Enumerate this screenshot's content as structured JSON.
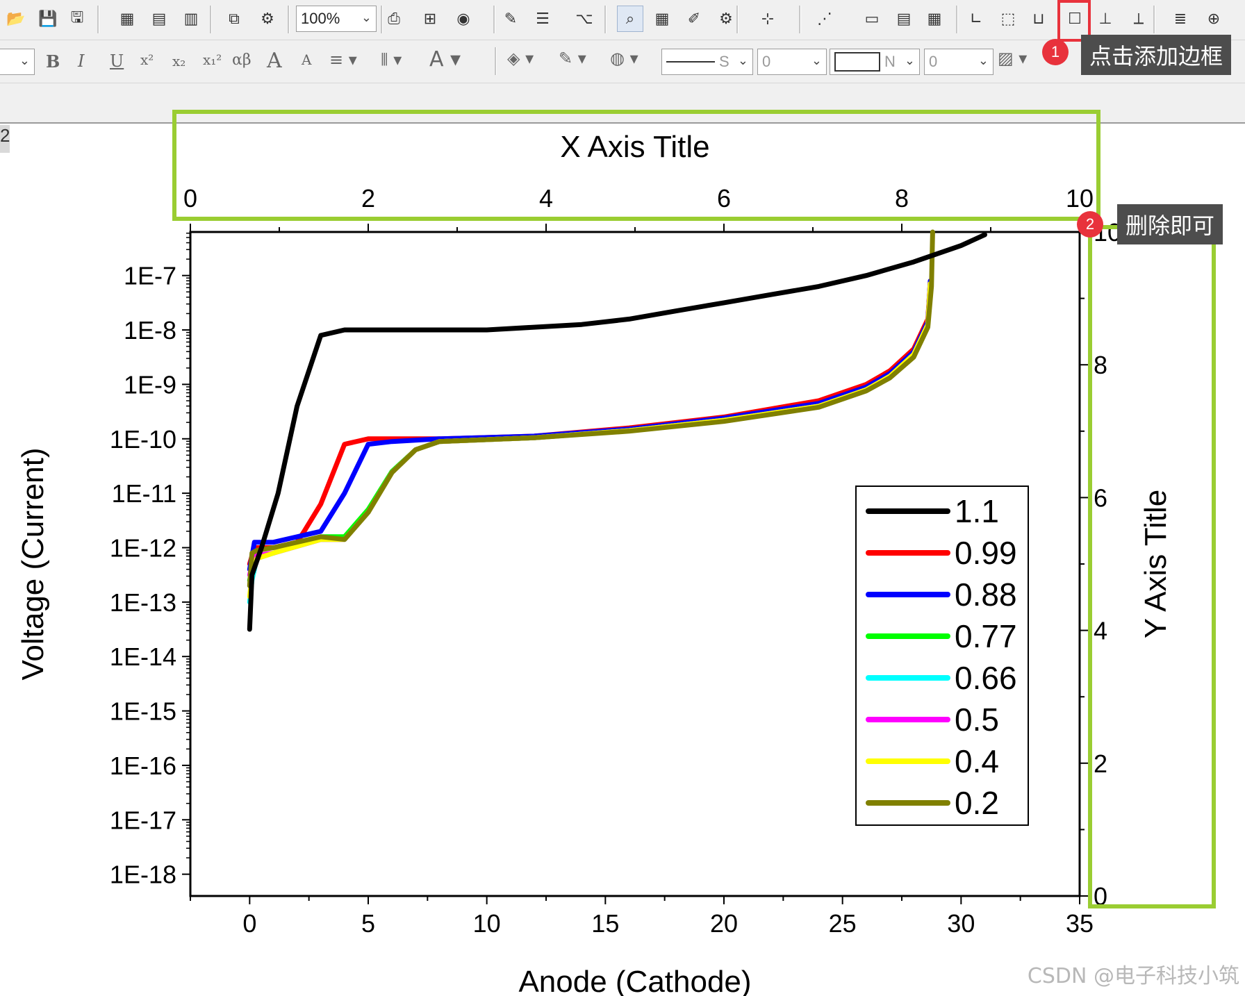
{
  "toolbar1": {
    "zoom_value": "100%",
    "icons": [
      "open-icon",
      "save-icon",
      "save-template-icon",
      "import-icon",
      "import-multi-icon",
      "import-wizard-icon",
      "duplicate-icon",
      "run-icon",
      "print-icon",
      "export-icon",
      "copy-page-icon",
      "code-builder-icon",
      "layer-icon",
      "tree-icon",
      "zoom-icon",
      "worksheet-icon",
      "notes-icon",
      "gear-icon",
      "add-axis-icon",
      "data-selector-icon",
      "layer-1-icon",
      "layer-2-icon",
      "layer-4-icon",
      "axis-l-icon",
      "axis-box-icon",
      "axis-right-icon",
      "border-icon",
      "axis-yy-icon",
      "axis-xy-icon",
      "list-icon",
      "plus-icon"
    ]
  },
  "toolbar2": {
    "font_combo": "",
    "bold": "B",
    "italic": "I",
    "underline": "U",
    "superscript": "x²",
    "subscript": "x₂",
    "supersub": "x₁²",
    "greek": "αβ",
    "font_up": "A",
    "font_down": "A",
    "line_style_combo": "S",
    "line_width_combo": "0",
    "fill_combo": "N",
    "fill_width_combo": "0"
  },
  "annotations": {
    "badge1": "1",
    "tip1": "点击添加边框",
    "badge2": "2",
    "tip2": "删除即可",
    "tab_fragment": "2",
    "watermark": "CSDN @电子科技小筑"
  },
  "colors": {
    "highlight_red": "#e8323c",
    "highlight_green": "#9acd32",
    "tooltip_bg": "#4d4d4d"
  },
  "chart_data": {
    "type": "line",
    "xlabel": "Anode (Cathode)",
    "ylabel": "Voltage (Current)",
    "xlim": [
      -2.5,
      35
    ],
    "x_ticks": [
      0,
      5,
      10,
      15,
      20,
      25,
      30,
      35
    ],
    "y_scale": "log",
    "ylim_exponent": [
      -18.4,
      -6.2
    ],
    "y_tick_labels": [
      "1E-7",
      "1E-8",
      "1E-9",
      "1E-10",
      "1E-11",
      "1E-12",
      "1E-13",
      "1E-14",
      "1E-15",
      "1E-16",
      "1E-17",
      "1E-18"
    ],
    "top_axis": {
      "title": "X Axis Title",
      "ticks": [
        "0",
        "2",
        "4",
        "6",
        "8",
        "10"
      ],
      "range": [
        0,
        10
      ]
    },
    "right_axis": {
      "title": "Y Axis Title",
      "ticks": [
        "0",
        "2",
        "4",
        "6",
        "8",
        "10"
      ],
      "range": [
        0,
        10
      ]
    },
    "legend_position": "right",
    "series": [
      {
        "name": "1.1",
        "color": "#000000",
        "x": [
          0,
          0.1,
          0.5,
          1.2,
          2,
          3,
          4,
          6,
          8,
          10,
          12,
          14,
          16,
          18,
          20,
          22,
          24,
          26,
          28,
          30,
          31
        ],
        "log10y": [
          -13.5,
          -12.5,
          -12.0,
          -11.0,
          -9.4,
          -8.1,
          -8.0,
          -8.0,
          -8.0,
          -8.0,
          -7.95,
          -7.9,
          -7.8,
          -7.65,
          -7.5,
          -7.35,
          -7.2,
          -7.0,
          -6.75,
          -6.45,
          -6.25
        ]
      },
      {
        "name": "0.99",
        "color": "#ff0000",
        "x": [
          0,
          0.2,
          1,
          2,
          2.3,
          3,
          4,
          5,
          8,
          12,
          16,
          20,
          24,
          26,
          27,
          28,
          28.6,
          28.7
        ],
        "log10y": [
          -12.3,
          -12.0,
          -12.0,
          -11.9,
          -11.7,
          -11.2,
          -10.1,
          -10.0,
          -10.0,
          -9.95,
          -9.8,
          -9.6,
          -9.3,
          -9.0,
          -8.75,
          -8.35,
          -7.8,
          -7.1
        ]
      },
      {
        "name": "0.88",
        "color": "#0000ff",
        "x": [
          0,
          0.2,
          1,
          3,
          4,
          5,
          6,
          8,
          12,
          16,
          20,
          24,
          26,
          27,
          28,
          28.6,
          28.7
        ],
        "log10y": [
          -12.4,
          -11.9,
          -11.9,
          -11.7,
          -11.0,
          -10.1,
          -10.05,
          -10.0,
          -9.95,
          -9.82,
          -9.62,
          -9.35,
          -9.05,
          -8.8,
          -8.4,
          -7.85,
          -7.1
        ]
      },
      {
        "name": "0.77",
        "color": "#00ff00",
        "x": [
          0,
          0.2,
          1,
          3,
          4,
          5,
          6,
          7,
          8,
          12,
          16,
          20,
          24,
          26,
          27,
          28,
          28.6,
          28.7
        ],
        "log10y": [
          -12.6,
          -12.2,
          -12.1,
          -11.8,
          -11.8,
          -11.3,
          -10.6,
          -10.2,
          -10.05,
          -9.98,
          -9.85,
          -9.66,
          -9.4,
          -9.1,
          -8.85,
          -8.45,
          -7.9,
          -7.15
        ]
      },
      {
        "name": "0.66",
        "color": "#00ffff",
        "x": [
          0,
          0.1,
          0.3,
          1,
          3,
          4,
          5,
          6,
          7,
          8,
          12,
          16,
          20,
          24,
          26,
          27,
          28,
          28.6,
          28.7
        ],
        "log10y": [
          -13.0,
          -12.6,
          -12.2,
          -12.1,
          -11.85,
          -11.85,
          -11.35,
          -10.62,
          -10.2,
          -10.05,
          -9.98,
          -9.85,
          -9.66,
          -9.4,
          -9.1,
          -8.85,
          -8.45,
          -7.9,
          -7.15
        ]
      },
      {
        "name": "0.5",
        "color": "#ff00ff",
        "x": [
          0,
          0.2,
          1,
          3,
          4,
          5,
          6,
          7,
          8,
          12,
          16,
          20,
          24,
          26,
          27,
          28,
          28.6,
          28.7
        ],
        "log10y": [
          -12.5,
          -12.15,
          -12.1,
          -11.85,
          -11.85,
          -11.35,
          -10.62,
          -10.2,
          -10.05,
          -9.98,
          -9.85,
          -9.66,
          -9.4,
          -9.1,
          -8.85,
          -8.45,
          -7.9,
          -7.15
        ]
      },
      {
        "name": "0.4",
        "color": "#ffff00",
        "x": [
          0,
          0.1,
          0.3,
          1,
          3,
          4,
          5,
          6,
          7,
          8,
          12,
          16,
          20,
          24,
          26,
          27,
          28,
          28.6,
          28.7
        ],
        "log10y": [
          -12.9,
          -12.5,
          -12.2,
          -12.1,
          -11.85,
          -11.85,
          -11.35,
          -10.62,
          -10.2,
          -10.05,
          -9.98,
          -9.85,
          -9.66,
          -9.4,
          -9.1,
          -8.85,
          -8.45,
          -7.9,
          -7.15
        ]
      },
      {
        "name": "0.2",
        "color": "#808000",
        "x": [
          0,
          0.1,
          0.3,
          1,
          3,
          4,
          5,
          6,
          7,
          8,
          12,
          16,
          20,
          24,
          26,
          27,
          28,
          28.6,
          28.75,
          28.8
        ],
        "log10y": [
          -12.7,
          -12.1,
          -12.05,
          -12.0,
          -11.8,
          -11.85,
          -11.35,
          -10.62,
          -10.2,
          -10.05,
          -9.98,
          -9.86,
          -9.68,
          -9.42,
          -9.12,
          -8.88,
          -8.5,
          -7.95,
          -7.2,
          -6.2
        ]
      }
    ]
  }
}
